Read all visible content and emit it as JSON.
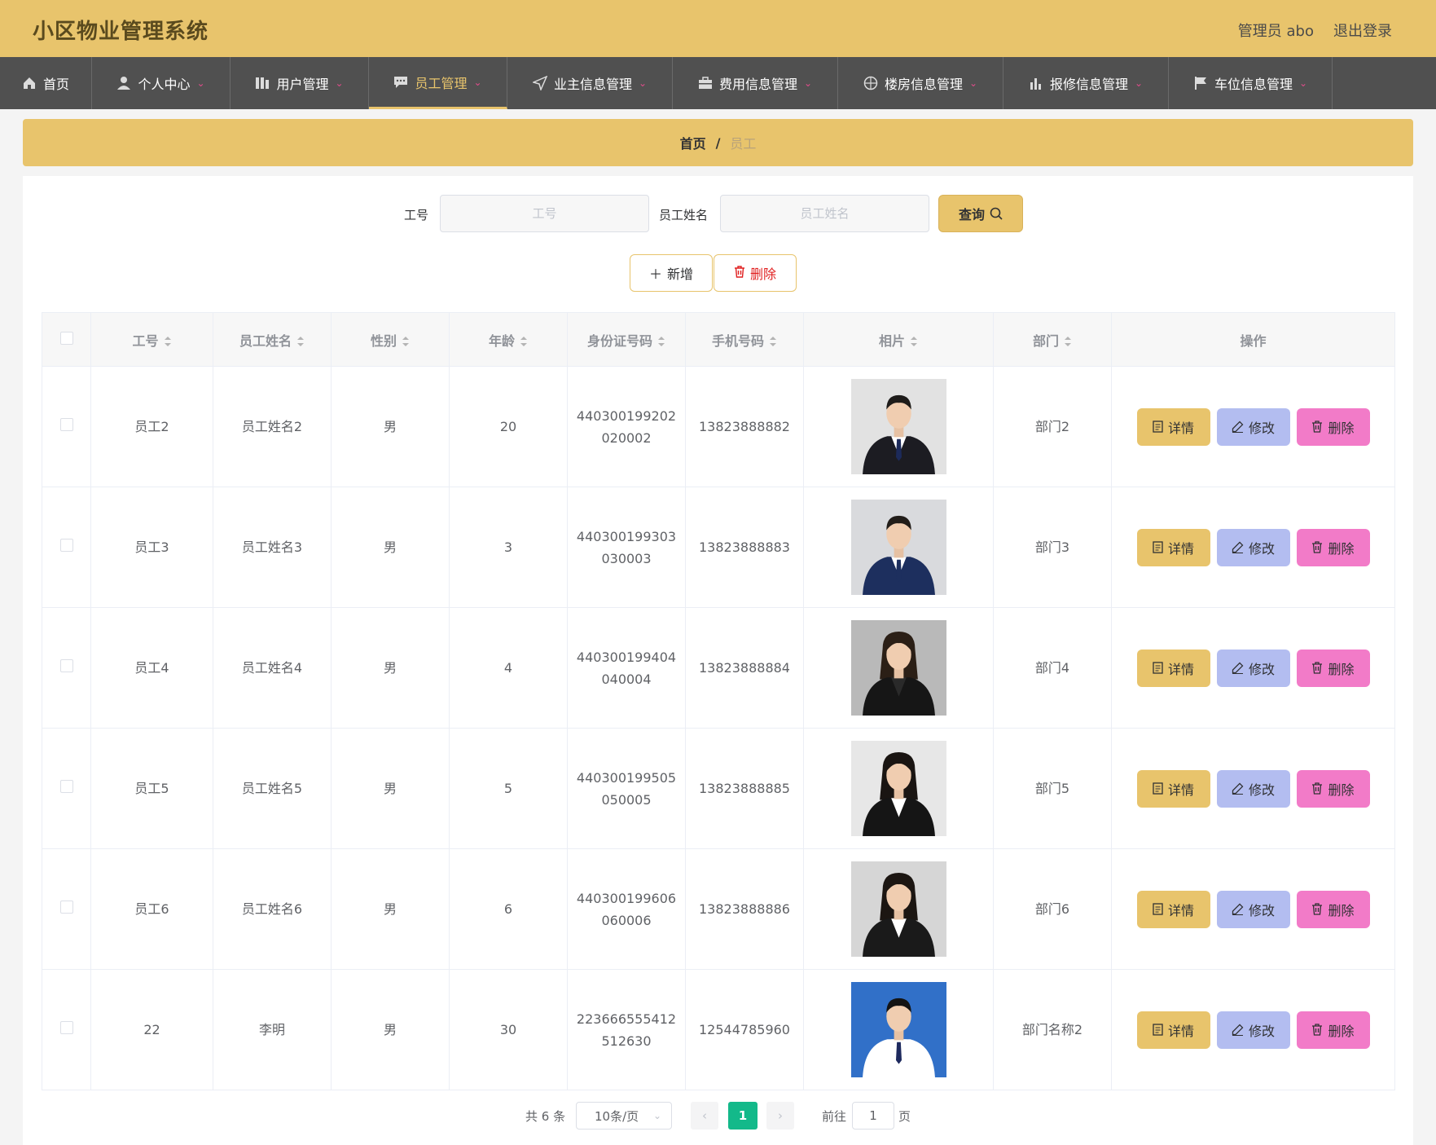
{
  "header": {
    "title": "小区物业管理系统",
    "user": "管理员 abo",
    "logout": "退出登录"
  },
  "nav": [
    {
      "label": "首页",
      "icon": "home-icon"
    },
    {
      "label": "个人中心",
      "icon": "user-icon"
    },
    {
      "label": "用户管理",
      "icon": "library-icon"
    },
    {
      "label": "员工管理",
      "icon": "chat-icon"
    },
    {
      "label": "业主信息管理",
      "icon": "send-icon"
    },
    {
      "label": "费用信息管理",
      "icon": "suitcase-icon"
    },
    {
      "label": "楼房信息管理",
      "icon": "globe-icon"
    },
    {
      "label": "报修信息管理",
      "icon": "bar-chart-icon"
    },
    {
      "label": "车位信息管理",
      "icon": "flag-icon"
    }
  ],
  "breadcrumb": {
    "home": "首页",
    "separator": "/",
    "current": "员工"
  },
  "search": {
    "id_label": "工号",
    "id_placeholder": "工号",
    "name_label": "员工姓名",
    "name_placeholder": "员工姓名",
    "query_label": "查询"
  },
  "toolbar": {
    "add_label": "新增",
    "delete_label": "删除"
  },
  "table": {
    "columns": [
      "工号",
      "员工姓名",
      "性别",
      "年龄",
      "身份证号码",
      "手机号码",
      "相片",
      "部门",
      "操作"
    ],
    "rows": [
      {
        "id": "员工2",
        "name": "员工姓名2",
        "gender": "男",
        "age": "20",
        "idcard": "440300199202020002",
        "phone": "13823888882",
        "dept": "部门2",
        "photo": {
          "bg": "#e2e2e2",
          "suit": "#1c1c22",
          "shirt": "#ffffff",
          "tie": "#1c2a5a",
          "hair": "#1e1c1a",
          "long_hair": false
        }
      },
      {
        "id": "员工3",
        "name": "员工姓名3",
        "gender": "男",
        "age": "3",
        "idcard": "440300199303030003",
        "phone": "13823888883",
        "dept": "部门3",
        "photo": {
          "bg": "#d9dadd",
          "suit": "#1d2f5e",
          "shirt": "#ffffff",
          "tie": "#1d2f5e",
          "hair": "#221d19",
          "long_hair": false
        }
      },
      {
        "id": "员工4",
        "name": "员工姓名4",
        "gender": "男",
        "age": "4",
        "idcard": "440300199404040004",
        "phone": "13823888884",
        "dept": "部门4",
        "photo": {
          "bg": "#b9b9b9",
          "suit": "#161616",
          "shirt": "#2a2a2a",
          "tie": "",
          "hair": "#2b1f16",
          "long_hair": true
        }
      },
      {
        "id": "员工5",
        "name": "员工姓名5",
        "gender": "男",
        "age": "5",
        "idcard": "440300199505050005",
        "phone": "13823888885",
        "dept": "部门5",
        "photo": {
          "bg": "#e7e7e7",
          "suit": "#151515",
          "shirt": "#ffffff",
          "tie": "",
          "hair": "#1a1512",
          "long_hair": true
        }
      },
      {
        "id": "员工6",
        "name": "员工姓名6",
        "gender": "男",
        "age": "6",
        "idcard": "440300199606060006",
        "phone": "13823888886",
        "dept": "部门6",
        "photo": {
          "bg": "#d6d6d6",
          "suit": "#1a1a1a",
          "shirt": "#ffffff",
          "tie": "",
          "hair": "#1c1612",
          "long_hair": true
        }
      },
      {
        "id": "22",
        "name": "李明",
        "gender": "男",
        "age": "30",
        "idcard": "223666555412512630",
        "phone": "12544785960",
        "dept": "部门名称2",
        "photo": {
          "bg": "#3170c8",
          "suit": "#ffffff",
          "shirt": "#ffffff",
          "tie": "#1e2a5e",
          "hair": "#141414",
          "long_hair": false
        }
      }
    ],
    "actions": {
      "detail": "详情",
      "edit": "修改",
      "delete": "删除"
    }
  },
  "pagination": {
    "total": "共 6 条",
    "page_size": "10条/页",
    "current_page": "1",
    "goto_label": "前往",
    "goto_value": "1",
    "page_suffix": "页"
  },
  "colors": {
    "accent": "#e8c46c",
    "nav_bg": "#505050",
    "page_active": "#13b98a",
    "edit": "#b3bdf0",
    "delete": "#f27bc8"
  }
}
